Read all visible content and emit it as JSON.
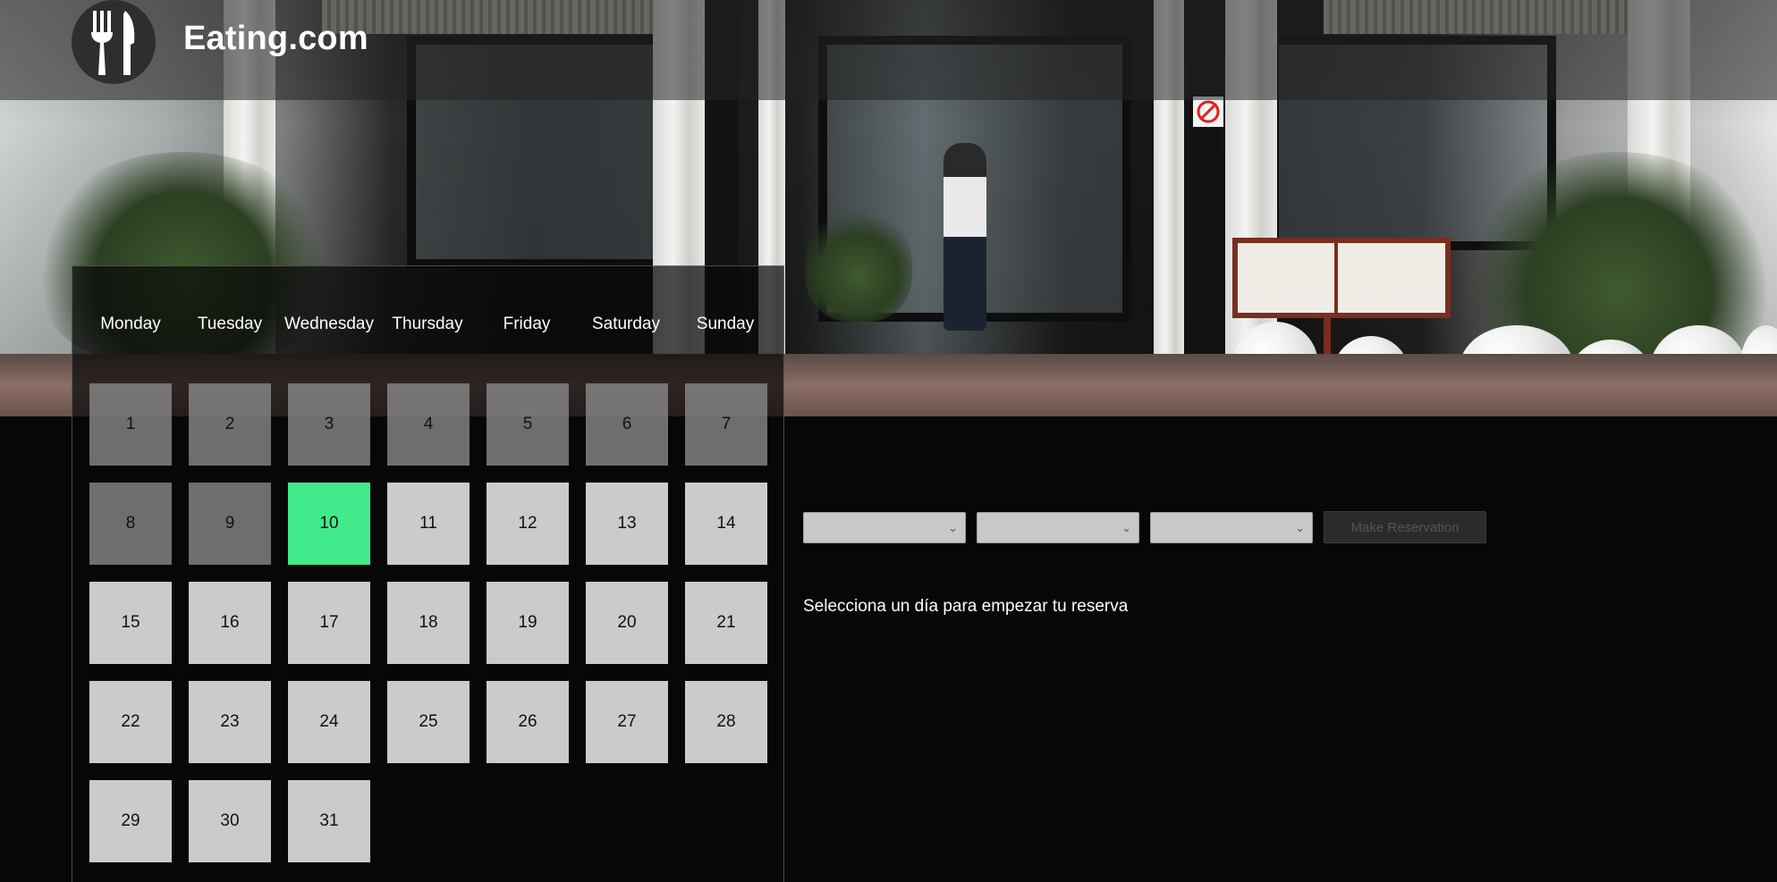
{
  "header": {
    "logo_icon": "fork-knife-icon",
    "title": "Eating.com"
  },
  "hero_image": "restaurant-terrace-photo",
  "calendar": {
    "weekdays": [
      "Monday",
      "Tuesday",
      "Wednesday",
      "Thursday",
      "Friday",
      "Saturday",
      "Sunday"
    ],
    "days": [
      {
        "label": "1",
        "state": "past"
      },
      {
        "label": "2",
        "state": "past"
      },
      {
        "label": "3",
        "state": "past"
      },
      {
        "label": "4",
        "state": "past"
      },
      {
        "label": "5",
        "state": "past"
      },
      {
        "label": "6",
        "state": "past"
      },
      {
        "label": "7",
        "state": "past"
      },
      {
        "label": "8",
        "state": "past"
      },
      {
        "label": "9",
        "state": "past"
      },
      {
        "label": "10",
        "state": "today"
      },
      {
        "label": "11",
        "state": "future"
      },
      {
        "label": "12",
        "state": "future"
      },
      {
        "label": "13",
        "state": "future"
      },
      {
        "label": "14",
        "state": "future"
      },
      {
        "label": "15",
        "state": "future"
      },
      {
        "label": "16",
        "state": "future"
      },
      {
        "label": "17",
        "state": "future"
      },
      {
        "label": "18",
        "state": "future"
      },
      {
        "label": "19",
        "state": "future"
      },
      {
        "label": "20",
        "state": "future"
      },
      {
        "label": "21",
        "state": "future"
      },
      {
        "label": "22",
        "state": "future"
      },
      {
        "label": "23",
        "state": "future"
      },
      {
        "label": "24",
        "state": "future"
      },
      {
        "label": "25",
        "state": "future"
      },
      {
        "label": "26",
        "state": "future"
      },
      {
        "label": "27",
        "state": "future"
      },
      {
        "label": "28",
        "state": "future"
      },
      {
        "label": "29",
        "state": "future"
      },
      {
        "label": "30",
        "state": "future"
      },
      {
        "label": "31",
        "state": "future"
      }
    ],
    "colors": {
      "past": "#8c8c8c",
      "today": "#41ea8a",
      "future": "#cbcbcb"
    }
  },
  "reservation": {
    "selects": [
      {
        "name": "select-1",
        "value": ""
      },
      {
        "name": "select-2",
        "value": ""
      },
      {
        "name": "select-3",
        "value": ""
      }
    ],
    "button_label": "Make Reservation",
    "hint": "Selecciona un día para empezar tu reserva"
  }
}
